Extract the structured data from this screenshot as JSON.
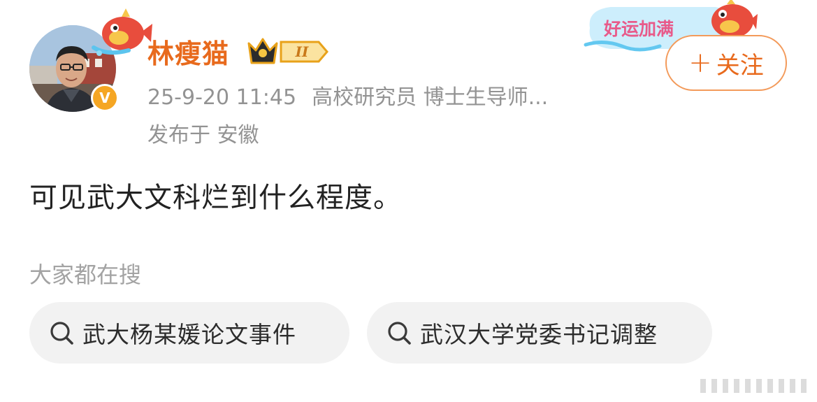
{
  "post": {
    "username": "林瘦猫",
    "vip_level": "II",
    "verified_mark": "V",
    "timestamp": "25-9-20 11:45",
    "bio": "高校研究员 博士生导师...",
    "location": "发布于 安徽",
    "follow_plus": "+",
    "follow_label": "关注",
    "banner_text": "好运加满",
    "content": "可见武大文科烂到什么程度。"
  },
  "trending": {
    "heading": "大家都在搜",
    "items": [
      {
        "label": "武大杨某媛论文事件",
        "icon": "search-icon"
      },
      {
        "label": "武汉大学党委书记调整",
        "icon": "search-icon"
      }
    ]
  },
  "colors": {
    "username": "#e86a1d",
    "accent": "#e86a1d",
    "meta": "#939393",
    "chip_bg": "#f2f2f2",
    "verified": "#f5a623"
  }
}
